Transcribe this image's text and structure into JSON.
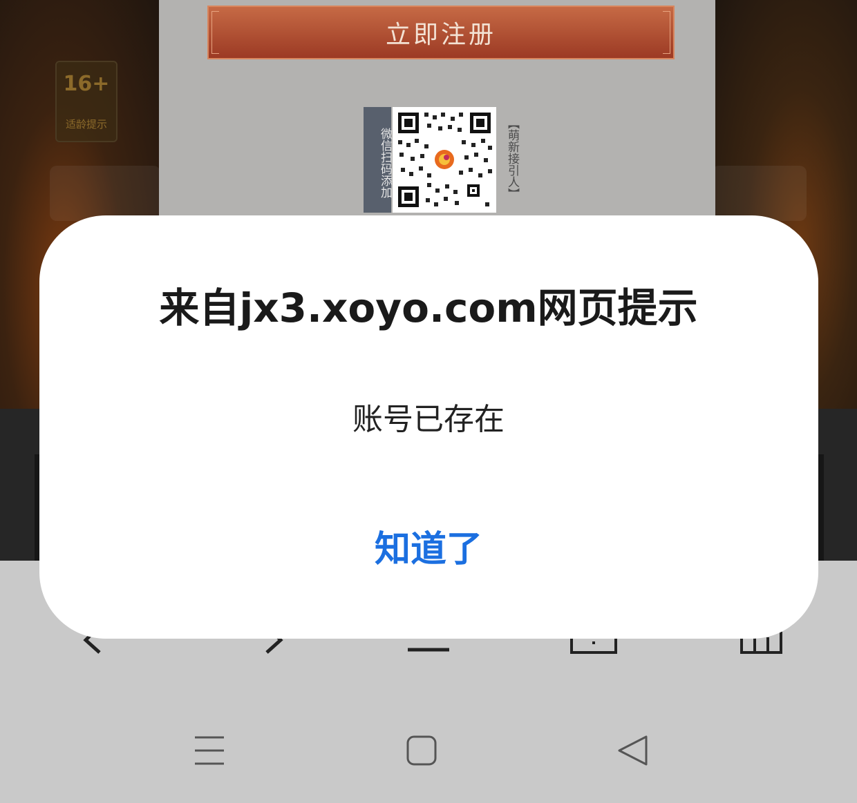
{
  "page": {
    "register_button": "立即注册",
    "age_badge": {
      "rating": "16+",
      "label": "适龄提示"
    },
    "qr": {
      "left_label": "微信扫码添加",
      "right_label": "【萌新接引人】"
    }
  },
  "dialog": {
    "title": "来自jx3.xoyo.com网页提示",
    "message": "账号已存在",
    "ok_label": "知道了",
    "ok_color": "#1b6fe0"
  },
  "browser_toolbar": {
    "icons": [
      "back-icon",
      "forward-icon",
      "menu-icon",
      "tabs-icon",
      "home-icon"
    ]
  },
  "system_nav": {
    "icons": [
      "recent-apps-icon",
      "home-square-icon",
      "back-triangle-icon"
    ]
  }
}
